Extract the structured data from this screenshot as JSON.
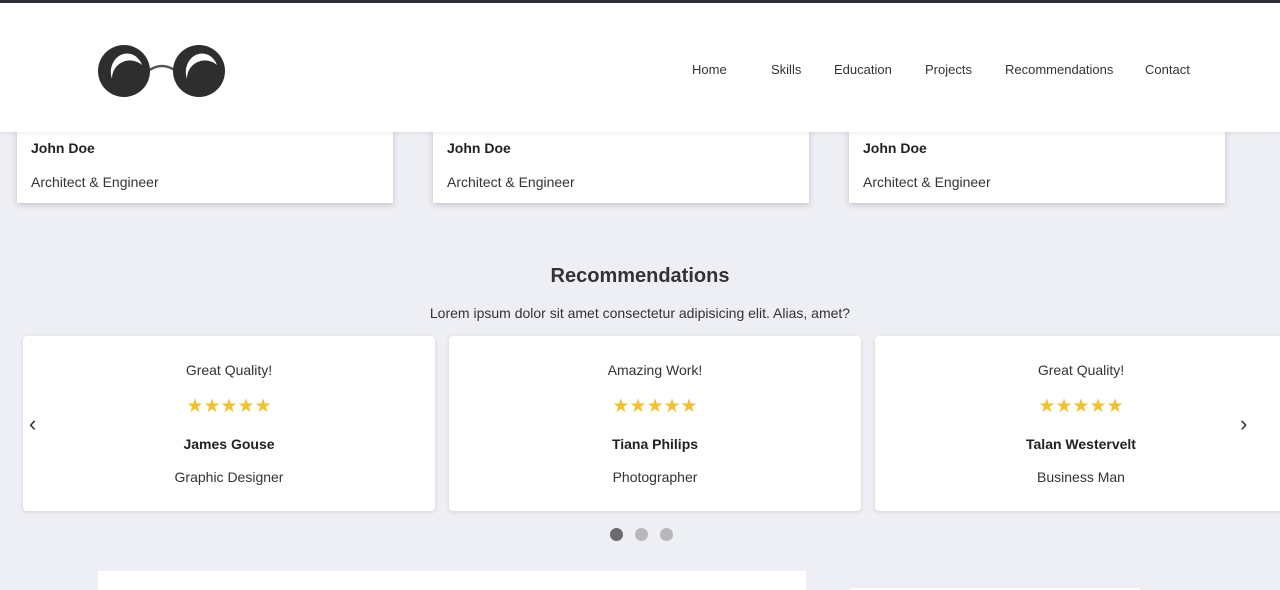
{
  "header": {
    "logo_icon": "glasses-logo-icon",
    "nav": [
      {
        "label": "Home"
      },
      {
        "label": "Skills"
      },
      {
        "label": "Education"
      },
      {
        "label": "Projects"
      },
      {
        "label": "Recommendations"
      },
      {
        "label": "Contact"
      }
    ]
  },
  "projects": [
    {
      "name": "John Doe",
      "role": "Architect & Engineer"
    },
    {
      "name": "John Doe",
      "role": "Architect & Engineer"
    },
    {
      "name": "John Doe",
      "role": "Architect & Engineer"
    }
  ],
  "recommendations": {
    "title": "Recommendations",
    "subtitle": "Lorem ipsum dolor sit amet consectetur adipisicing elit. Alias, amet?",
    "cards": [
      {
        "quote": "Great Quality!",
        "stars": "★★★★★",
        "name": "James Gouse",
        "role": "Graphic Designer"
      },
      {
        "quote": "Amazing Work!",
        "stars": "★★★★★",
        "name": "Tiana Philips",
        "role": "Photographer"
      },
      {
        "quote": "Great Quality!",
        "stars": "★★★★★",
        "name": "Talan Westervelt",
        "role": "Business Man"
      }
    ],
    "prev_arrow": "‹",
    "next_arrow": "›",
    "dots": 3,
    "active_dot": 1
  },
  "colors": {
    "page_background": "#eeeff4",
    "star": "#f2c12e",
    "active_dot": "#6b6b6f",
    "inactive_dot": "#b8b8bc",
    "top_border": "#2d2f36"
  }
}
